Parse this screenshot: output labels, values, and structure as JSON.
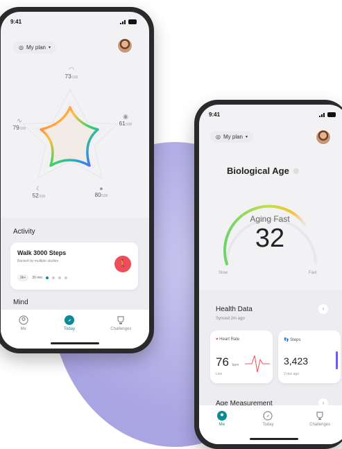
{
  "phone1": {
    "time": "9:41",
    "plan_label": "My plan",
    "metrics": [
      {
        "value": "73",
        "unit": "/100"
      },
      {
        "value": "79",
        "unit": "/100"
      },
      {
        "value": "61",
        "unit": "/100"
      },
      {
        "value": "52",
        "unit": "/100"
      },
      {
        "value": "80",
        "unit": "/100"
      }
    ],
    "activity_title": "Activity",
    "activity_card": {
      "title": "Walk 3000 Steps",
      "subtitle": "Backed by multiple studies",
      "chip1": "3k+",
      "chip2": "30 min"
    },
    "mind_title": "Mind",
    "tabs": [
      "Me",
      "Today",
      "Challenges"
    ]
  },
  "phone2": {
    "time": "9:41",
    "plan_label": "My plan",
    "bio_title": "Biological Age",
    "gauge_status": "Aging Fast",
    "gauge_value": "32",
    "gauge_slow": "Slow",
    "gauge_fast": "Fast",
    "health_title": "Health Data",
    "synced": "Synced 2m ago",
    "heart_label": "Heart Rate",
    "heart_value": "76",
    "heart_unit": "bpm",
    "heart_sub": "Live",
    "steps_label": "Steps",
    "steps_value": "3,423",
    "steps_sub": "2 min ago",
    "age_title": "Age Measurement",
    "tabs": [
      "Me",
      "Today",
      "Challenges"
    ]
  },
  "colors": {
    "accent": "#0b8b96",
    "red": "#ef4d57",
    "purple": "#6b5ce7"
  }
}
